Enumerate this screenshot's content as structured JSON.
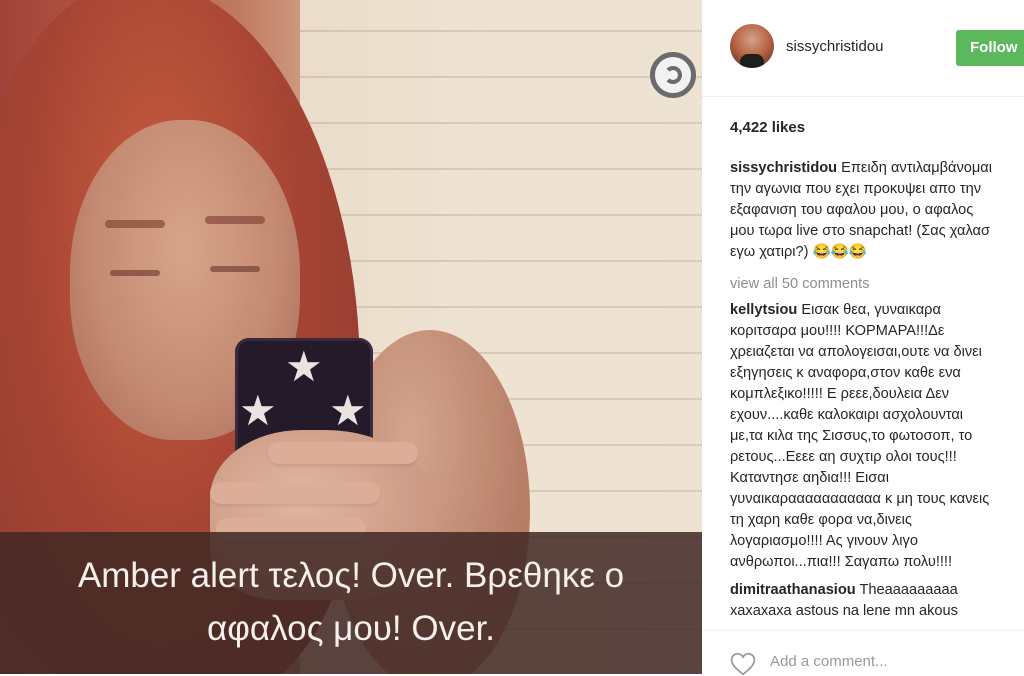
{
  "post": {
    "caption_overlay": {
      "line1": "Amber alert τελος! Over. Βρεθηκε ο",
      "line2": "αφαλος μου! Over."
    },
    "icon": "circle-loading-icon"
  },
  "sidebar": {
    "username": "sissychristidou",
    "follow_label": "Follow",
    "likes": "4,422 likes",
    "caption": {
      "user": "sissychristidou",
      "lines": [
        "Επειδη αντιλαμβάνομαι",
        "την αγωνια που εχει προκυψει απο την",
        "εξαφανιση του αφαλου μου, ο αφαλος",
        "μου τωρα live στο snapchat! (Σας χαλασ",
        "εγω χατιρι?) 😂😂😂"
      ]
    },
    "view_all": "view all 50 comments",
    "comments": [
      {
        "user": "kellytsiou",
        "lines": [
          "Εισακ θεα, γυναικαρα",
          "κοριτσαρα μου!!!! ΚΟΡΜΑΡΑ!!!Δε",
          "χρειαζεται να απολογεισαι,ουτε να δινει",
          "εξηγησεις κ αναφορα,στον καθε ενα",
          "κομπλεξικο!!!!! Ε ρεεε,δουλεια Δεν",
          "εχουν....καθε καλοκαιρι ασχολουνται",
          "με,τα κιλα της Σισσυς,το φωτοσοπ, το",
          "ρετους...Εεεε αη συχτιρ ολοι τους!!!",
          "Καταντησε αηδια!!! Εισαι",
          "γυναικαρααααααααααα κ μη τους κανεις",
          "τη χαρη καθε φορα να,δινεις",
          "λογαριασμο!!!! Ας γινουν λιγο",
          "ανθρωποι...πια!!! Σαγαπω πολυ!!!!"
        ]
      },
      {
        "user": "dimitraathanasiou",
        "lines": [
          "Theaaaaaaaaa",
          "xaxaxaxa astous na lene mn akous"
        ]
      }
    ],
    "add_comment_placeholder": "Add a comment...",
    "heart_icon": "heart-icon"
  }
}
